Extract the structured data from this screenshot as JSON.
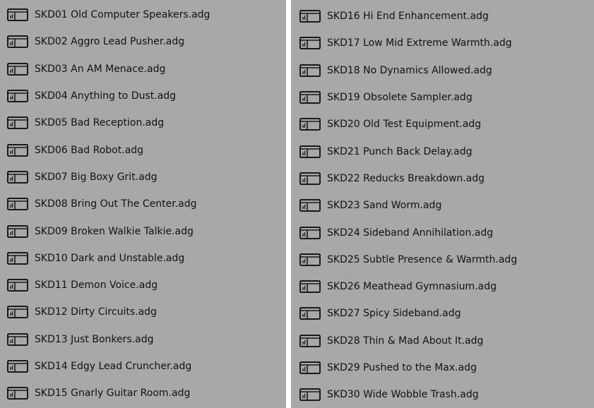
{
  "columns": [
    {
      "items": [
        {
          "label": "SKD01 Old Computer Speakers.adg",
          "icon": "rack-preset-icon"
        },
        {
          "label": "SKD02 Aggro Lead Pusher.adg",
          "icon": "rack-preset-icon"
        },
        {
          "label": "SKD03 An AM Menace.adg",
          "icon": "rack-preset-icon"
        },
        {
          "label": "SKD04 Anything to Dust.adg",
          "icon": "rack-preset-icon"
        },
        {
          "label": "SKD05 Bad Reception.adg",
          "icon": "rack-preset-icon"
        },
        {
          "label": "SKD06 Bad Robot.adg",
          "icon": "rack-preset-icon"
        },
        {
          "label": "SKD07 Big Boxy Grit.adg",
          "icon": "rack-preset-icon"
        },
        {
          "label": "SKD08 Bring Out The Center.adg",
          "icon": "rack-preset-icon"
        },
        {
          "label": "SKD09 Broken Walkie Talkie.adg",
          "icon": "rack-preset-icon"
        },
        {
          "label": "SKD10 Dark and Unstable.adg",
          "icon": "rack-preset-icon"
        },
        {
          "label": "SKD11 Demon Voice.adg",
          "icon": "rack-preset-icon"
        },
        {
          "label": "SKD12 Dirty Circuits.adg",
          "icon": "rack-preset-icon"
        },
        {
          "label": "SKD13 Just Bonkers.adg",
          "icon": "rack-preset-icon"
        },
        {
          "label": "SKD14 Edgy Lead Cruncher.adg",
          "icon": "rack-preset-icon"
        },
        {
          "label": "SKD15 Gnarly Guitar Room.adg",
          "icon": "rack-preset-icon"
        }
      ]
    },
    {
      "items": [
        {
          "label": "SKD16 Hi End Enhancement.adg",
          "icon": "rack-preset-icon"
        },
        {
          "label": "SKD17 Low Mid Extreme Warmth.adg",
          "icon": "rack-preset-icon"
        },
        {
          "label": "SKD18 No Dynamics Allowed.adg",
          "icon": "rack-preset-icon"
        },
        {
          "label": "SKD19 Obsolete Sampler.adg",
          "icon": "rack-preset-icon"
        },
        {
          "label": "SKD20 Old Test Equipment.adg",
          "icon": "rack-preset-icon"
        },
        {
          "label": "SKD21 Punch Back Delay.adg",
          "icon": "rack-preset-icon"
        },
        {
          "label": "SKD22 Reducks Breakdown.adg",
          "icon": "rack-preset-icon"
        },
        {
          "label": "SKD23 Sand Worm.adg",
          "icon": "rack-preset-icon"
        },
        {
          "label": "SKD24 Sideband Annihilation.adg",
          "icon": "rack-preset-icon"
        },
        {
          "label": "SKD25 Subtle Presence & Warmth.adg",
          "icon": "rack-preset-icon"
        },
        {
          "label": "SKD26 Meathead Gymnasium.adg",
          "icon": "rack-preset-icon"
        },
        {
          "label": "SKD27 Spicy Sideband.adg",
          "icon": "rack-preset-icon"
        },
        {
          "label": "SKD28 Thin & Mad About It.adg",
          "icon": "rack-preset-icon"
        },
        {
          "label": "SKD29 Pushed to the Max.adg",
          "icon": "rack-preset-icon"
        },
        {
          "label": "SKD30 Wide Wobble Trash.adg",
          "icon": "rack-preset-icon"
        }
      ]
    }
  ],
  "colors": {
    "panel_background": "#a8a8a8",
    "text": "#121212",
    "icon": "#1a1a1a",
    "gap": "#ffffff"
  }
}
